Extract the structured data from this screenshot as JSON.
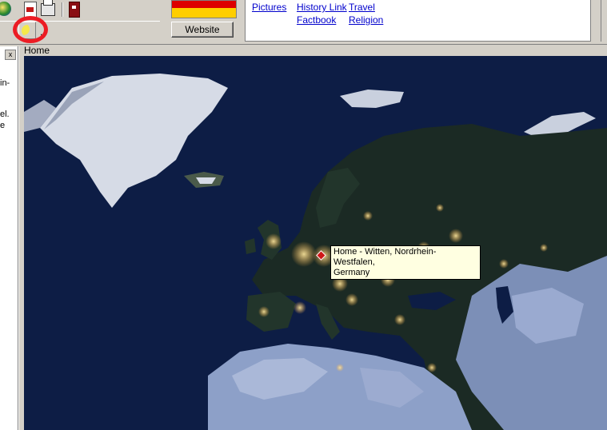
{
  "toolbar": {
    "icons": [
      "globe-icon",
      "pdf-icon",
      "print-icon",
      "exit-door-icon",
      "night-moon-icon"
    ],
    "website_label": "Website"
  },
  "flag": {
    "country": "Germany",
    "colors": [
      "#000000",
      "#dd0000",
      "#ffce00"
    ]
  },
  "links": {
    "pictures": "Pictures",
    "history_link": "History Link",
    "travel": "Travel",
    "factbook": "Factbook",
    "religion": "Religion"
  },
  "left_panel": {
    "close_label": "x",
    "text_fragments": [
      "in-",
      "el.",
      "e"
    ]
  },
  "map": {
    "title": "Home",
    "tooltip_line1": "Home - Witten, Nordrhein-Westfalen,",
    "tooltip_line2": "Germany"
  },
  "colors": {
    "highlight": "#ec1c24",
    "link": "#0000cc",
    "tooltip_bg": "#ffffe1"
  }
}
